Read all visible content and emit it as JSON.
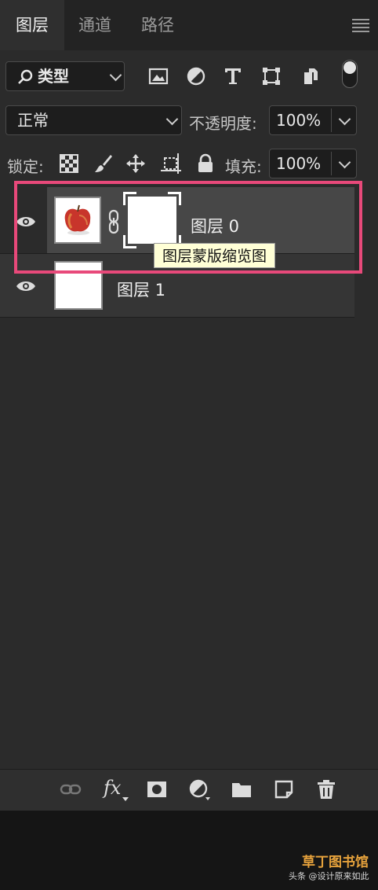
{
  "tabs": [
    {
      "label": "图层",
      "active": true
    },
    {
      "label": "通道",
      "active": false
    },
    {
      "label": "路径",
      "active": false
    }
  ],
  "filter": {
    "kind_value": "类型",
    "icons": [
      "image-filter-icon",
      "adjustment-filter-icon",
      "type-filter-icon",
      "shape-filter-icon",
      "smart-object-filter-icon"
    ],
    "toggle_on": true
  },
  "blend": {
    "mode_value": "正常",
    "opacity_label": "不透明度:",
    "opacity_value": "100%"
  },
  "lock": {
    "label": "锁定:",
    "fill_label": "填充:",
    "fill_value": "100%",
    "icons": [
      "lock-transparent-pixels-icon",
      "lock-image-pixels-icon",
      "lock-position-icon",
      "artboard-icon",
      "lock-all-icon"
    ]
  },
  "layers": [
    {
      "name": "图层 0",
      "visible": true,
      "has_mask": true,
      "selected": true
    },
    {
      "name": "图层 1",
      "visible": true,
      "has_mask": false,
      "selected": false
    }
  ],
  "tooltip": "图层蒙版缩览图",
  "colors": {
    "panel_bg": "#2b2b2b",
    "selected_row": "#474747",
    "highlight": "#e8497a",
    "tooltip_bg": "#ffffd6"
  },
  "bottom_toolbar": [
    "link-layers-icon",
    "fx-icon",
    "add-mask-icon",
    "adjustment-layer-icon",
    "new-group-icon",
    "new-layer-icon",
    "delete-icon"
  ],
  "bottom_toolbar_fx_label": "fx",
  "watermark": {
    "brand": "草丁图书馆",
    "credit": "头条 @设计原来如此"
  }
}
